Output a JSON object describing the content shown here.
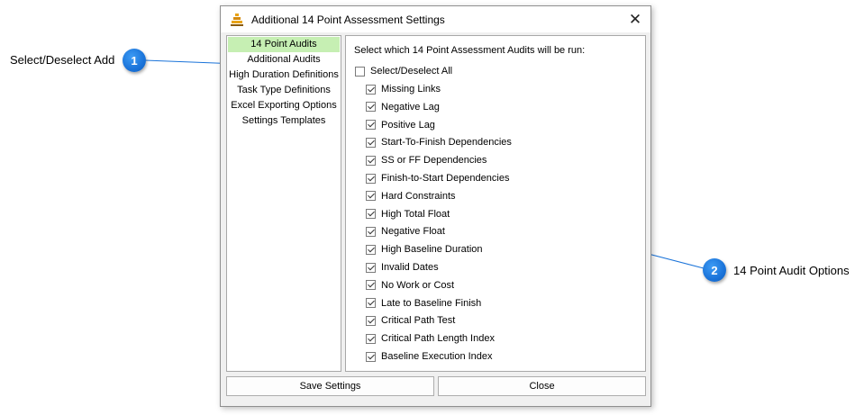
{
  "window": {
    "title": "Additional 14 Point Assessment Settings",
    "close_glyph": "✕",
    "app_icon": "stacked-bars-icon"
  },
  "sidebar": {
    "items": [
      {
        "label": "14 Point Audits",
        "active": true
      },
      {
        "label": "Additional Audits"
      },
      {
        "label": "High Duration Definitions"
      },
      {
        "label": "Task Type Definitions"
      },
      {
        "label": "Excel Exporting Options"
      },
      {
        "label": "Settings Templates"
      }
    ]
  },
  "panel": {
    "heading": "Select which 14 Point Assessment Audits will be run:",
    "select_all": {
      "label": "Select/Deselect All",
      "checked": false
    },
    "audits": [
      {
        "label": "Missing Links",
        "checked": true
      },
      {
        "label": "Negative Lag",
        "checked": true
      },
      {
        "label": "Positive Lag",
        "checked": true
      },
      {
        "label": "Start-To-Finish Dependencies",
        "checked": true
      },
      {
        "label": "SS or FF Dependencies",
        "checked": true
      },
      {
        "label": "Finish-to-Start Dependencies",
        "checked": true
      },
      {
        "label": "Hard Constraints",
        "checked": true
      },
      {
        "label": "High Total Float",
        "checked": true
      },
      {
        "label": "Negative Float",
        "checked": true
      },
      {
        "label": "High Baseline Duration",
        "checked": true
      },
      {
        "label": "Invalid Dates",
        "checked": true
      },
      {
        "label": "No Work or Cost",
        "checked": true
      },
      {
        "label": "Late to Baseline Finish",
        "checked": true
      },
      {
        "label": "Critical Path Test",
        "checked": true
      },
      {
        "label": "Critical Path Length Index",
        "checked": true
      },
      {
        "label": "Baseline Execution Index",
        "checked": true
      }
    ]
  },
  "buttons": {
    "save": "Save Settings",
    "close": "Close"
  },
  "callouts": [
    {
      "number": "1",
      "text": "Select/Deselect Add"
    },
    {
      "number": "2",
      "text": "14 Point Audit Options"
    }
  ],
  "colors": {
    "active_tab": "#c6efb3",
    "callout_badge": "#1a73d9",
    "callout_line": "#1a73d9"
  }
}
